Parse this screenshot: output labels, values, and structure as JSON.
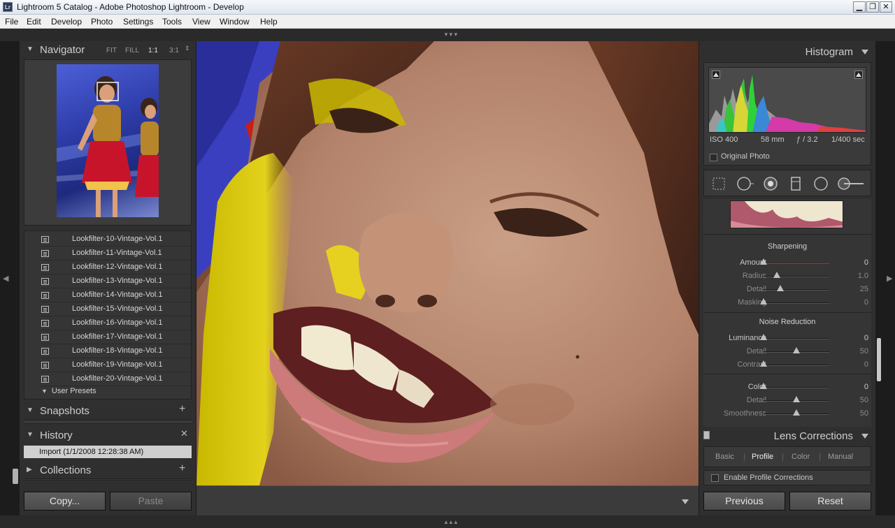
{
  "window": {
    "title": "Lightroom 5 Catalog - Adobe Photoshop Lightroom - Develop",
    "app_icon": "Lr",
    "controls": [
      "minimize-icon",
      "restore-icon",
      "close-icon"
    ]
  },
  "menu": [
    "File",
    "Edit",
    "Develop",
    "Photo",
    "Settings",
    "Tools",
    "View",
    "Window",
    "Help"
  ],
  "navigator": {
    "title": "Navigator",
    "zoom_options": [
      "FIT",
      "FILL",
      "1:1",
      "3:1"
    ],
    "active_zoom": "1:1"
  },
  "presets": {
    "items": [
      "Lookfilter-10-Vintage-Vol.1",
      "Lookfilter-11-Vintage-Vol.1",
      "Lookfilter-12-Vintage-Vol.1",
      "Lookfilter-13-Vintage-Vol.1",
      "Lookfilter-14-Vintage-Vol.1",
      "Lookfilter-15-Vintage-Vol.1",
      "Lookfilter-16-Vintage-Vol.1",
      "Lookfilter-17-Vintage-Vol.1",
      "Lookfilter-18-Vintage-Vol.1",
      "Lookfilter-19-Vintage-Vol.1",
      "Lookfilter-20-Vintage-Vol.1"
    ],
    "user_presets": "User Presets"
  },
  "snapshots": {
    "title": "Snapshots"
  },
  "history": {
    "title": "History",
    "items": [
      "Import (1/1/2008 12:28:38 AM)"
    ]
  },
  "collections": {
    "title": "Collections"
  },
  "left_buttons": {
    "copy": "Copy...",
    "paste": "Paste"
  },
  "histogram": {
    "title": "Histogram",
    "iso": "ISO 400",
    "focal": "58 mm",
    "aperture": "ƒ / 3.2",
    "shutter": "1/400 sec",
    "original_photo": "Original Photo"
  },
  "sharpening": {
    "title": "Sharpening",
    "sliders": [
      {
        "label": "Amount",
        "value": "0",
        "pos": 0.0,
        "dim": false,
        "red": true
      },
      {
        "label": "Radius",
        "value": "1.0",
        "pos": 0.2,
        "dim": true,
        "red": false
      },
      {
        "label": "Detail",
        "value": "25",
        "pos": 0.25,
        "dim": true,
        "red": false
      },
      {
        "label": "Masking",
        "value": "0",
        "pos": 0.0,
        "dim": true,
        "red": false
      }
    ]
  },
  "noise_reduction": {
    "title": "Noise Reduction",
    "luminance": [
      {
        "label": "Luminance",
        "value": "0",
        "pos": 0.0,
        "dim": false
      },
      {
        "label": "Detail",
        "value": "50",
        "pos": 0.5,
        "dim": true
      },
      {
        "label": "Contrast",
        "value": "0",
        "pos": 0.0,
        "dim": true
      }
    ],
    "color": [
      {
        "label": "Color",
        "value": "0",
        "pos": 0.0,
        "dim": false
      },
      {
        "label": "Detail",
        "value": "50",
        "pos": 0.5,
        "dim": true
      },
      {
        "label": "Smoothness",
        "value": "50",
        "pos": 0.5,
        "dim": true
      }
    ]
  },
  "lens_corrections": {
    "title": "Lens Corrections",
    "tabs": [
      "Basic",
      "Profile",
      "Color",
      "Manual"
    ],
    "active_tab": "Profile",
    "enable_profile": "Enable Profile Corrections"
  },
  "right_buttons": {
    "previous": "Previous",
    "reset": "Reset"
  }
}
